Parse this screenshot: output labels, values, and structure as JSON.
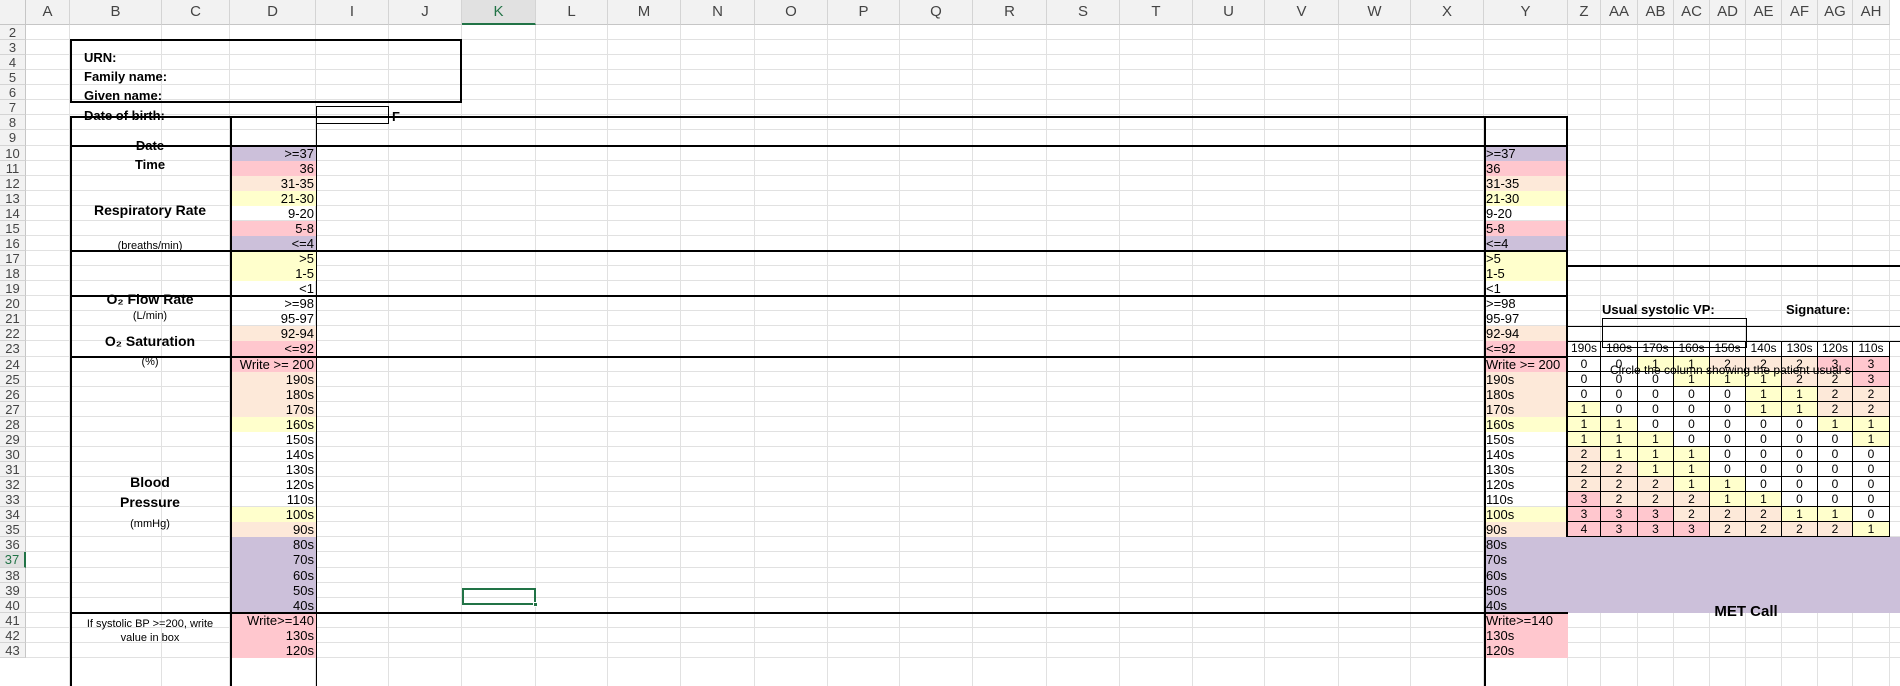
{
  "grid": {
    "columns": [
      "A",
      "B",
      "C",
      "D",
      "I",
      "J",
      "K",
      "L",
      "M",
      "N",
      "O",
      "P",
      "Q",
      "R",
      "S",
      "T",
      "U",
      "V",
      "W",
      "X",
      "Y",
      "Z",
      "AA",
      "AB",
      "AC",
      "AD",
      "AE",
      "AF",
      "AG",
      "AH"
    ],
    "rows": [
      2,
      3,
      4,
      5,
      6,
      7,
      8,
      9,
      10,
      11,
      12,
      13,
      14,
      15,
      16,
      17,
      18,
      19,
      20,
      21,
      22,
      23,
      24,
      25,
      26,
      27,
      28,
      29,
      30,
      31,
      32,
      33,
      34,
      35,
      36,
      37,
      38,
      39,
      40,
      41,
      42,
      43
    ],
    "selected_column": "K",
    "selected_row": 37
  },
  "patient": {
    "urn": "URN:",
    "family_name": "Family name:",
    "given_name": "Given name:",
    "dob": "Date of birth:",
    "gender": "F"
  },
  "headers": {
    "date": "Date",
    "time": "Time"
  },
  "sections": {
    "resp_title": "Respiratory Rate",
    "resp_unit": "(breaths/min)",
    "o2flow_title": "O₂ Flow Rate",
    "o2flow_unit": "(L/min)",
    "o2sat_title": "O₂ Saturation",
    "o2sat_unit": "(%)",
    "bp_title": "Blood Pressure",
    "bp_unit": "(mmHg)",
    "bp_note": "If systolic BP >=200, write value in box"
  },
  "scale_rows": [
    {
      "d": ">=37",
      "y": ">=37",
      "color": "purple"
    },
    {
      "d": "36",
      "y": "36",
      "color": "pink"
    },
    {
      "d": "31-35",
      "y": "31-35",
      "color": "peach"
    },
    {
      "d": "21-30",
      "y": "21-30",
      "color": "yellow"
    },
    {
      "d": "9-20",
      "y": "9-20",
      "color": "white"
    },
    {
      "d": "5-8",
      "y": "5-8",
      "color": "pink"
    },
    {
      "d": "<=4",
      "y": "<=4",
      "color": "purple"
    },
    {
      "d": ">5",
      "y": ">5",
      "color": "yellow"
    },
    {
      "d": "1-5",
      "y": "1-5",
      "color": "yellow"
    },
    {
      "d": "<1",
      "y": "<1",
      "color": "white"
    },
    {
      "d": ">=98",
      "y": ">=98",
      "color": "white"
    },
    {
      "d": "95-97",
      "y": "95-97",
      "color": "white"
    },
    {
      "d": "92-94",
      "y": "92-94",
      "color": "peach"
    },
    {
      "d": "<=92",
      "y": "<=92",
      "color": "pink"
    },
    {
      "d": "Write >= 200",
      "y": "Write >= 200",
      "color": "pink"
    },
    {
      "d": "190s",
      "y": "190s",
      "color": "peach"
    },
    {
      "d": "180s",
      "y": "180s",
      "color": "peach"
    },
    {
      "d": "170s",
      "y": "170s",
      "color": "peach"
    },
    {
      "d": "160s",
      "y": "160s",
      "color": "yellow"
    },
    {
      "d": "150s",
      "y": "150s",
      "color": "white"
    },
    {
      "d": "140s",
      "y": "140s",
      "color": "white"
    },
    {
      "d": "130s",
      "y": "130s",
      "color": "white"
    },
    {
      "d": "120s",
      "y": "120s",
      "color": "white"
    },
    {
      "d": "110s",
      "y": "110s",
      "color": "white"
    },
    {
      "d": "100s",
      "y": "100s",
      "color": "yellow"
    },
    {
      "d": "90s",
      "y": "90s",
      "color": "peach"
    },
    {
      "d": "80s",
      "y": "80s",
      "color": "purple"
    },
    {
      "d": "70s",
      "y": "70s",
      "color": "purple"
    },
    {
      "d": "60s",
      "y": "60s",
      "color": "purple"
    },
    {
      "d": "50s",
      "y": "50s",
      "color": "purple"
    },
    {
      "d": "40s",
      "y": "40s",
      "color": "purple"
    },
    {
      "d": "Write>=140",
      "y": "Write>=140",
      "color": "pink"
    },
    {
      "d": "130s",
      "y": "130s",
      "color": "pink"
    },
    {
      "d": "120s",
      "y": "120s",
      "color": "pink"
    }
  ],
  "side_panel": {
    "usual_systolic": "Usual systolic VP:",
    "signature": "Signature:",
    "circle_note": "Circle the column showing the patient usual s",
    "columns": [
      "190s",
      "180s",
      "170s",
      "160s",
      "150s",
      "140s",
      "130s",
      "120s",
      "110s"
    ],
    "rows": [
      [
        0,
        0,
        1,
        1,
        2,
        2,
        2,
        3,
        3
      ],
      [
        0,
        0,
        0,
        1,
        1,
        1,
        2,
        2,
        3
      ],
      [
        0,
        0,
        0,
        0,
        0,
        1,
        1,
        2,
        2
      ],
      [
        1,
        0,
        0,
        0,
        0,
        1,
        1,
        2,
        2
      ],
      [
        1,
        1,
        0,
        0,
        0,
        0,
        0,
        1,
        1
      ],
      [
        1,
        1,
        1,
        0,
        0,
        0,
        0,
        0,
        1
      ],
      [
        2,
        1,
        1,
        1,
        0,
        0,
        0,
        0,
        0
      ],
      [
        2,
        2,
        1,
        1,
        0,
        0,
        0,
        0,
        0
      ],
      [
        2,
        2,
        2,
        1,
        1,
        0,
        0,
        0,
        0
      ],
      [
        3,
        2,
        2,
        2,
        1,
        1,
        0,
        0,
        0
      ],
      [
        3,
        3,
        3,
        2,
        2,
        2,
        1,
        1,
        0
      ],
      [
        4,
        3,
        3,
        3,
        2,
        2,
        2,
        2,
        1
      ]
    ],
    "met_call": "MET Call"
  },
  "colors": {
    "purple": "#ccc0da",
    "pink": "#ffc7ce",
    "peach": "#fde9d9",
    "yellow": "#ffffcc",
    "selection": "#217346"
  }
}
